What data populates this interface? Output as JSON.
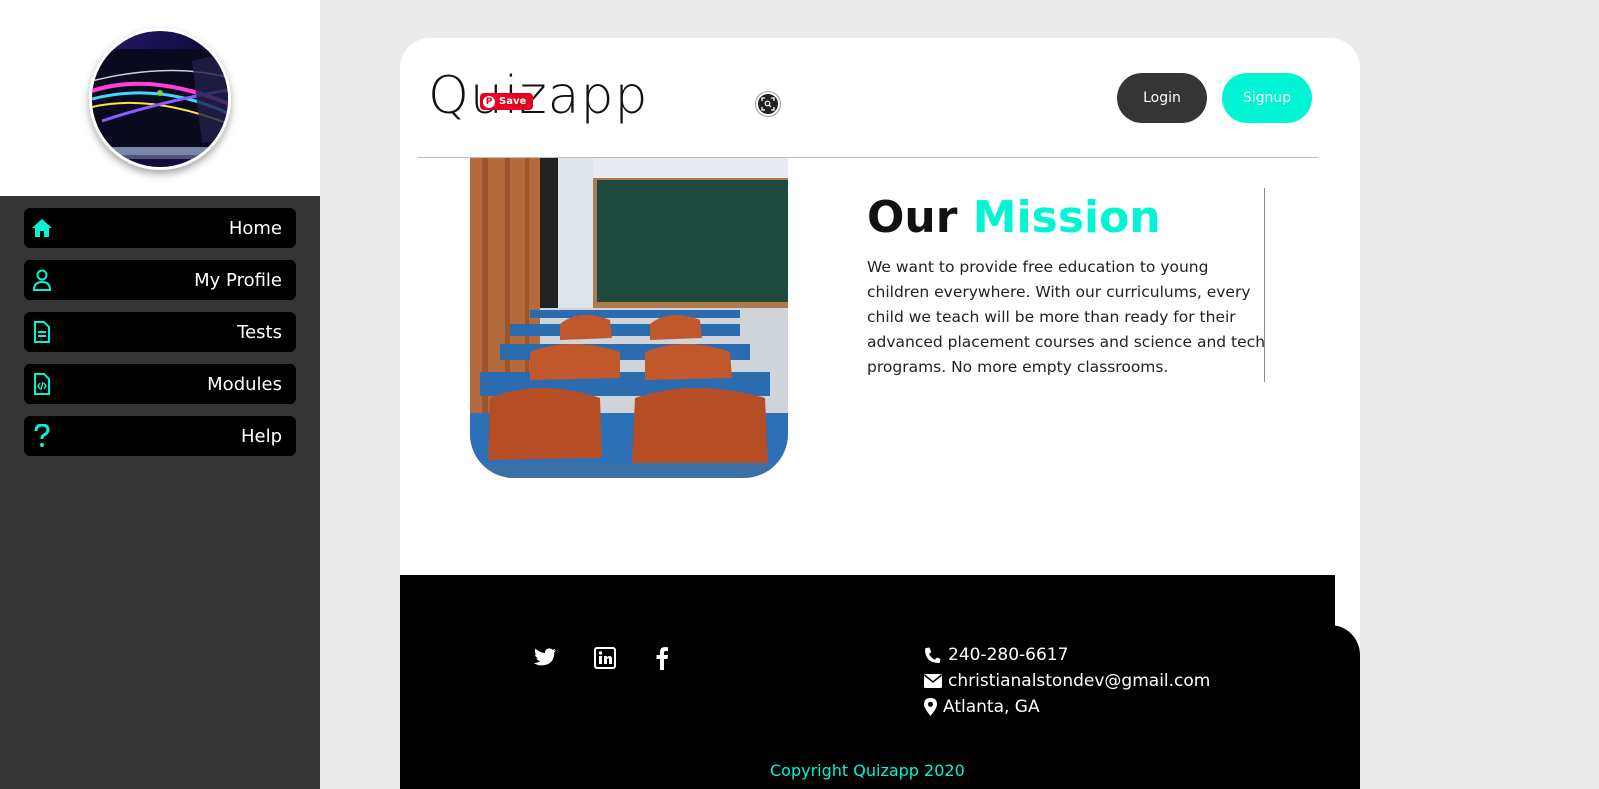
{
  "sidebar": {
    "items": [
      {
        "label": "Home",
        "icon": "home-icon"
      },
      {
        "label": "My Profile",
        "icon": "user-icon"
      },
      {
        "label": "Tests",
        "icon": "document-icon"
      },
      {
        "label": "Modules",
        "icon": "code-file-icon"
      },
      {
        "label": "Help",
        "icon": "question-icon"
      }
    ]
  },
  "header": {
    "brand": "Quizapp",
    "pin_save_label": "Save",
    "login_label": "Login",
    "signup_label": "Signup"
  },
  "mission": {
    "title_word1": "Our",
    "title_word2": "Mission",
    "text": "We want to provide free education to young children everywhere. With our curriculums, every child we teach will be more than ready for their advanced placement courses and science and tech programs. No more empty classrooms."
  },
  "footer": {
    "phone": "240-280-6617",
    "email": "christianalstondev@gmail.com",
    "location": "Atlanta, GA",
    "copyright": "Copyright Quizapp 2020",
    "social": [
      "twitter-icon",
      "linkedin-icon",
      "facebook-icon"
    ]
  },
  "colors": {
    "accent": "#00f5d4",
    "sidebar_bg": "#353535",
    "nav_item_bg": "#000000",
    "page_bg": "#ebebeb",
    "login_bg": "#353535",
    "pinterest_red": "#e60023"
  }
}
